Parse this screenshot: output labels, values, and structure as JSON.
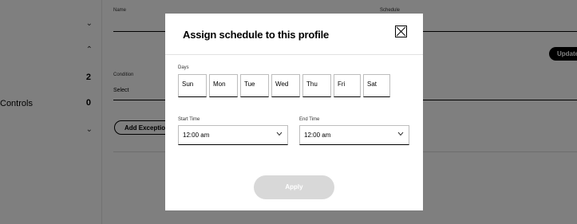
{
  "background": {
    "sidebar": {
      "rows": [
        {
          "label": "",
          "count": "",
          "chevron": "⌄"
        },
        {
          "label": "",
          "count": "",
          "chevron": "⌃"
        },
        {
          "label": "",
          "count": "2",
          "chevron": ""
        },
        {
          "label": "Controls",
          "count": "0",
          "chevron": ""
        },
        {
          "label": "",
          "count": "",
          "chevron": "⌄"
        }
      ]
    },
    "form": {
      "name_label": "Name",
      "schedule_label": "Schedule",
      "condition_label": "Condition",
      "condition_value": "Select",
      "add_exception_label": "Add Exception",
      "update_label": "Update"
    }
  },
  "modal": {
    "title": "Assign schedule to this profile",
    "close_icon": "close-icon",
    "days_label": "Days",
    "days": [
      "Sun",
      "Mon",
      "Tue",
      "Wed",
      "Thu",
      "Fri",
      "Sat"
    ],
    "start_time": {
      "label": "Start Time",
      "value": "12:00 am"
    },
    "end_time": {
      "label": "End Time",
      "value": "12:00 am"
    },
    "apply_label": "Apply"
  },
  "colors": {
    "overlay": "rgba(0,0,0,0.5)",
    "apply_disabled": "#d8d8d8",
    "update_button": "#000000"
  }
}
